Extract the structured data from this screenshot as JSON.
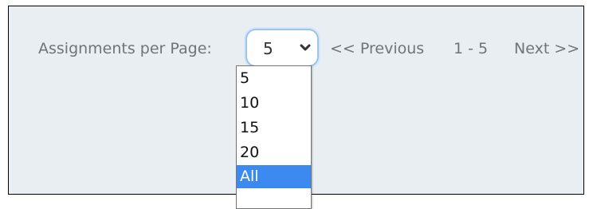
{
  "pagination": {
    "per_page_label": "Assignments per Page:",
    "select": {
      "value": "5",
      "options": [
        "5",
        "10",
        "15",
        "20",
        "All"
      ],
      "highlighted": "All",
      "chevron_icon": "chevron-down-icon"
    },
    "previous_label": "<< Previous",
    "range_label": "1 - 5",
    "next_label": "Next >>"
  },
  "colors": {
    "panel_background": "#e9eef2",
    "text_muted": "#6f7479",
    "focus_ring": "#9ec4ec",
    "highlight": "#3c8af0"
  }
}
